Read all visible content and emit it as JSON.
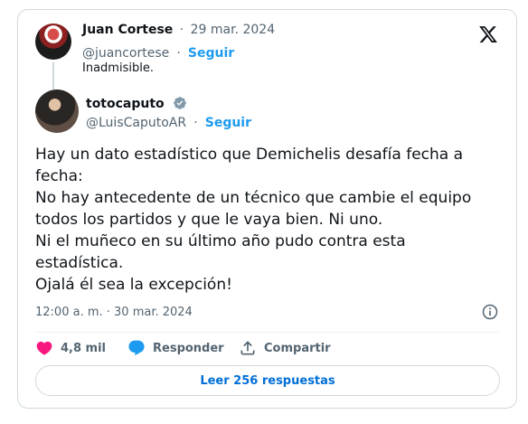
{
  "quoted": {
    "name": "Juan Cortese",
    "date": "29 mar. 2024",
    "handle": "@juancortese",
    "follow": "Seguir",
    "text": "Inadmisible."
  },
  "tweet": {
    "name": "totocaputo",
    "handle": "@LuisCaputoAR",
    "follow": "Seguir",
    "verified_icon": "verified-badge-gray",
    "text": "Hay un dato estadístico que Demichelis desafía fecha a\nfecha:\nNo hay antecedente de un técnico que cambie el equipo\ntodos los partidos y que le vaya bien. Ni uno.\nNi el muñeco en su último año pudo contra esta\nestadística.\nOjalá él sea la excepción!",
    "timestamp": "12:00 a. m. · 30 mar. 2024"
  },
  "actions": {
    "likes": "4,8 mil",
    "reply": "Responder",
    "share": "Compartir"
  },
  "read_replies": "Leer 256 respuestas",
  "colors": {
    "accent": "#1d9bf0",
    "like": "#f91880",
    "muted": "#536471"
  }
}
